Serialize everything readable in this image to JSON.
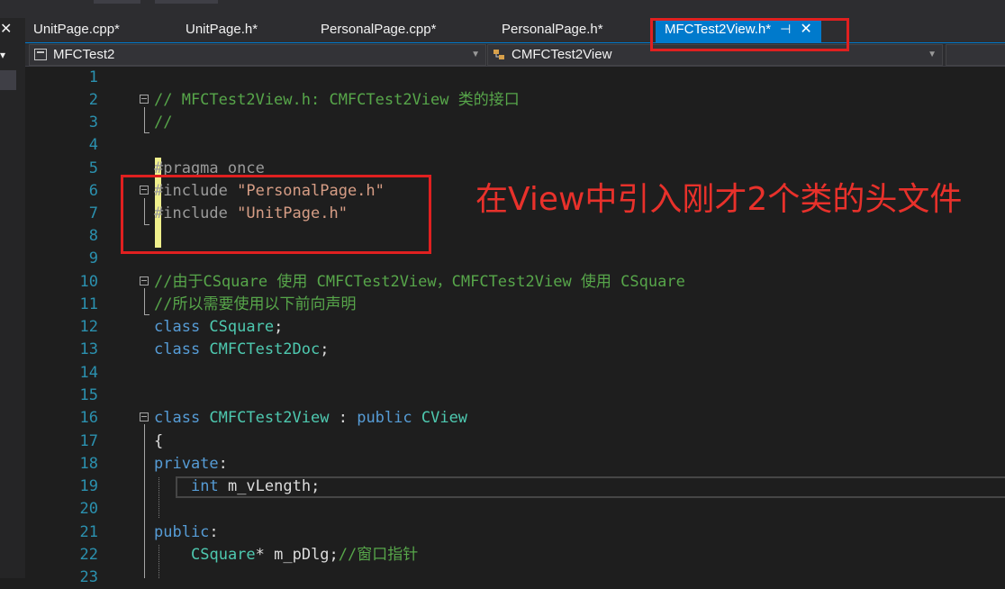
{
  "tabs": [
    {
      "label": "UnitPage.cpp*",
      "active": false
    },
    {
      "label": "UnitPage.h*",
      "active": false
    },
    {
      "label": "PersonalPage.cpp*",
      "active": false
    },
    {
      "label": "PersonalPage.h*",
      "active": false
    },
    {
      "label": "MFCTest2View.h*",
      "active": true
    }
  ],
  "navbar": {
    "project": "MFCTest2",
    "scope": "CMFCTest2View"
  },
  "left_panel": {
    "close_glyph": "✕",
    "dropdown_glyph": "▾"
  },
  "lines": [
    {
      "num": "1"
    },
    {
      "num": "2",
      "text": "// MFCTest2View.h: CMFCTest2View 类的接口"
    },
    {
      "num": "3",
      "text": "//"
    },
    {
      "num": "4"
    },
    {
      "num": "5",
      "text": "#pragma once"
    },
    {
      "num": "6",
      "directive": "#include ",
      "string": "\"PersonalPage.h\""
    },
    {
      "num": "7",
      "directive": "#include ",
      "string": "\"UnitPage.h\""
    },
    {
      "num": "8"
    },
    {
      "num": "9"
    },
    {
      "num": "10",
      "text": "//由于CSquare 使用 CMFCTest2View，CMFCTest2View 使用 CSquare"
    },
    {
      "num": "11",
      "text": "//所以需要使用以下前向声明"
    },
    {
      "num": "12",
      "kw": "class ",
      "name": "CSquare",
      "rest": ";"
    },
    {
      "num": "13",
      "kw": "class ",
      "name": "CMFCTest2Doc",
      "rest": ";"
    },
    {
      "num": "14"
    },
    {
      "num": "15"
    },
    {
      "num": "16",
      "kw": "class ",
      "name": "CMFCTest2View",
      "rest": " : ",
      "kw2": "public ",
      "name2": "CView"
    },
    {
      "num": "17",
      "text": "{"
    },
    {
      "num": "18",
      "kw": "private",
      "rest": ":"
    },
    {
      "num": "19",
      "kw": "int ",
      "rest": "m_vLength;"
    },
    {
      "num": "20"
    },
    {
      "num": "21",
      "kw": "public",
      "rest": ":"
    },
    {
      "num": "22",
      "name": "CSquare",
      "rest": "* m_pDlg;",
      "comment": "//窗口指针"
    },
    {
      "num": "23"
    }
  ],
  "annotation": "在View中引入刚才2个类的头文件",
  "colors": {
    "annotation": "#e8312b",
    "tab_active": "#007acc",
    "line_numbers": "#2b91af"
  }
}
